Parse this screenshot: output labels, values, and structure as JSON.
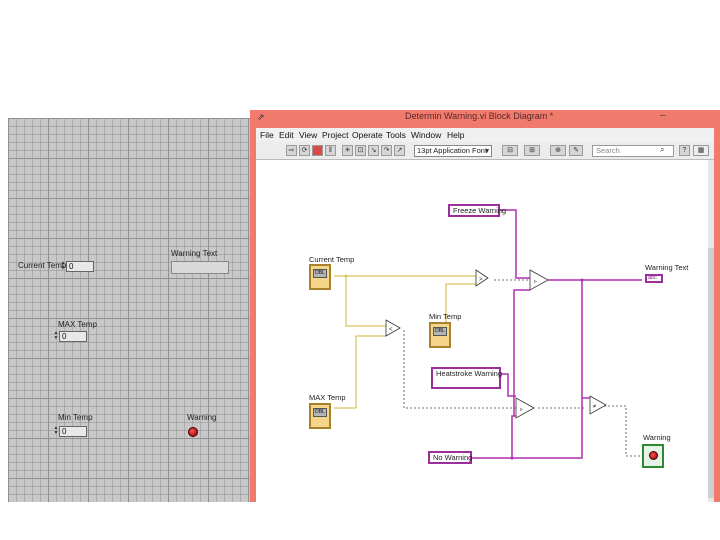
{
  "window": {
    "title": "Determin Warning.vi Block Diagram *",
    "app_icon": "labview-icon",
    "minimize_glyph": "–"
  },
  "menu": [
    "File",
    "Edit",
    "View",
    "Project",
    "Operate",
    "Tools",
    "Window",
    "Help"
  ],
  "toolbar": {
    "font": "13pt Application Font",
    "search_placeholder": "Search",
    "icons": [
      "run-arrow-icon",
      "run-continuous-icon",
      "abort-icon",
      "pause-icon",
      "highlight-execution-icon",
      "retain-wire-values-icon",
      "step-into-icon",
      "step-over-icon",
      "step-out-icon",
      "align-icon",
      "distribute-icon",
      "reorder-icon",
      "cleanup-icon",
      "search-icon",
      "help-icon"
    ]
  },
  "front_panel": {
    "current_temp": {
      "label": "Current Temp",
      "value": "0"
    },
    "max_temp": {
      "label": "MAX Temp",
      "value": "0"
    },
    "min_temp": {
      "label": "Min Temp",
      "value": "0"
    },
    "warning_text": {
      "label": "Warning Text",
      "value": ""
    },
    "warning": {
      "label": "Warning",
      "state": "on"
    }
  },
  "block_diagram": {
    "current_temp_label": "Current Temp",
    "current_temp_type": "DBL",
    "max_temp_label": "MAX Temp",
    "max_temp_type": "DBL",
    "min_temp_label": "Min Temp",
    "min_temp_type": "DBL",
    "freeze_warning": "Freeze Warning",
    "heatstroke_warning": "Heatstroke Warning",
    "no_warning": "No Warning",
    "warning_text_label": "Warning Text",
    "warning_text_type": "abc",
    "warning_label": "Warning",
    "colors": {
      "numeric_wire": "#d9c25a",
      "string_wire": "#b02fb0",
      "boolean_wire": "#2f8a2f"
    }
  }
}
